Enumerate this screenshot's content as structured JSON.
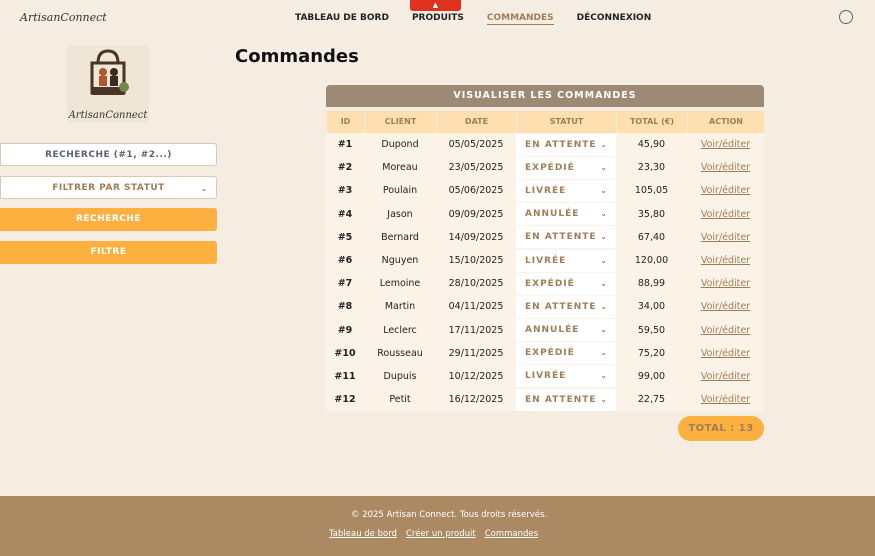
{
  "header": {
    "logo": "ArtisanConnect",
    "nav": [
      "TABLEAU DE BORD",
      "PRODUITS",
      "COMMANDES",
      "DÉCONNEXION"
    ],
    "active": "COMMANDES"
  },
  "brand": {
    "name": "ArtisanConnect"
  },
  "page": {
    "title": "Commandes"
  },
  "sidebar": {
    "search_placeholder": "RECHERCHE (#1, #2...)",
    "filter_select": "FILTRER PAR STATUT",
    "search_button": "RECHERCHE",
    "filter_button": "FILTRE"
  },
  "table": {
    "title": "VISUALISER LES COMMANDES",
    "columns": [
      "ID",
      "CLIENT",
      "DATE",
      "STATUT",
      "TOTAL (€)",
      "ACTION"
    ],
    "rows": [
      [
        "#1",
        "Dupond",
        "05/05/2025",
        "EN ATTENTE",
        "45,90",
        "Voir/éditer"
      ],
      [
        "#2",
        "Moreau",
        "23/05/2025",
        "EXPÉDIÉ",
        "23,30",
        "Voir/éditer"
      ],
      [
        "#3",
        "Poulain",
        "05/06/2025",
        "LIVRÉE",
        "105,05",
        "Voir/éditer"
      ],
      [
        "#4",
        "Jason",
        "09/09/2025",
        "ANNULÉE",
        "35,80",
        "Voir/éditer"
      ],
      [
        "#5",
        "Bernard",
        "14/09/2025",
        "EN ATTENTE",
        "67,40",
        "Voir/éditer"
      ],
      [
        "#6",
        "Nguyen",
        "15/10/2025",
        "LIVRÉE",
        "120,00",
        "Voir/éditer"
      ],
      [
        "#7",
        "Lemoine",
        "28/10/2025",
        "EXPÉDIÉ",
        "88,99",
        "Voir/éditer"
      ],
      [
        "#8",
        "Martin",
        "04/11/2025",
        "EN ATTENTE",
        "34,00",
        "Voir/éditer"
      ],
      [
        "#9",
        "Leclerc",
        "17/11/2025",
        "ANNULÉE",
        "59,50",
        "Voir/éditer"
      ],
      [
        "#10",
        "Rousseau",
        "29/11/2025",
        "EXPÉDIÉ",
        "75,20",
        "Voir/éditer"
      ],
      [
        "#11",
        "Dupuis",
        "10/12/2025",
        "LIVRÉE",
        "99,00",
        "Voir/éditer"
      ],
      [
        "#12",
        "Petit",
        "16/12/2025",
        "EN ATTENTE",
        "22,75",
        "Voir/éditer"
      ]
    ],
    "total": "TOTAL : 13"
  },
  "footer": {
    "copyright": "© 2025 Artisan Connect. Tous droits réservés.",
    "links": [
      "Tableau de bord",
      "Créer un produit",
      "Commandes"
    ]
  },
  "colors": {
    "background": "#f5ede1",
    "accent": "#fbb040",
    "brown": "#a07e55",
    "footer": "#ab8962"
  }
}
